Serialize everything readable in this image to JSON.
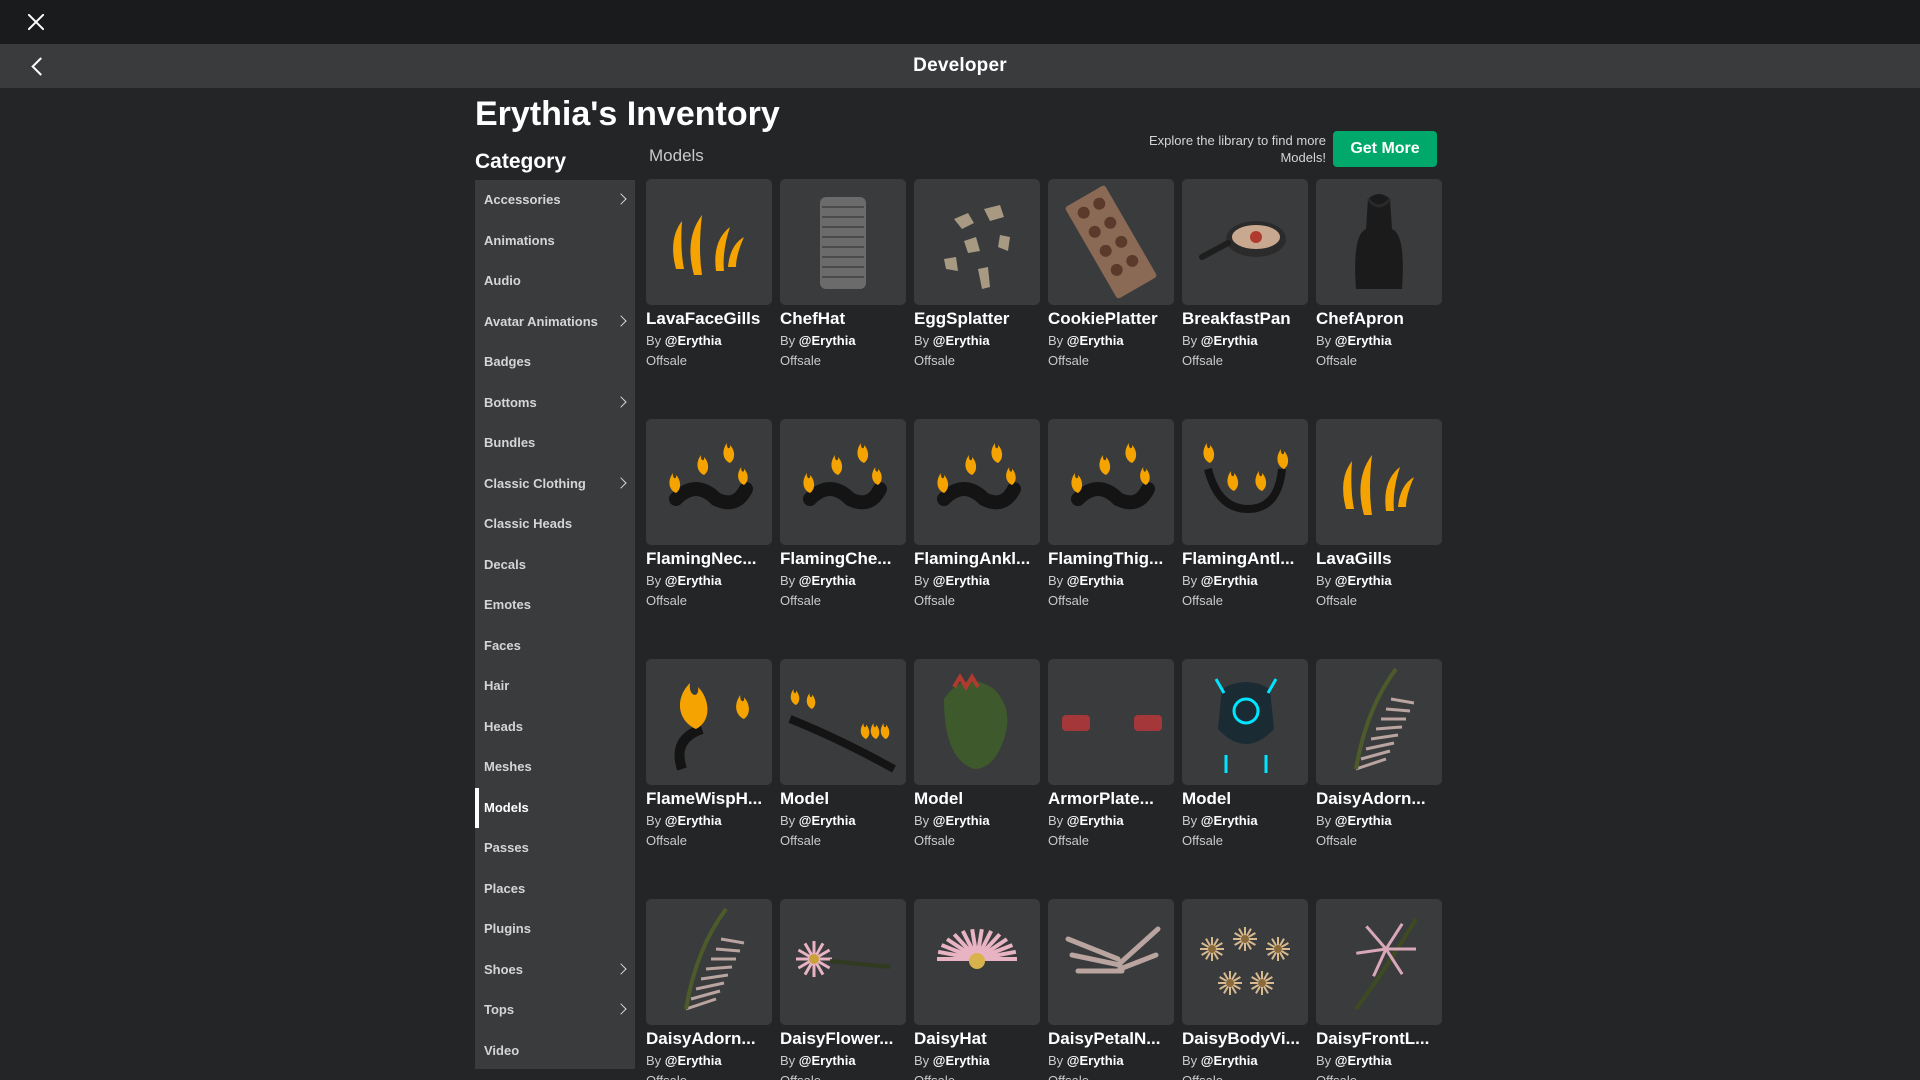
{
  "window": {
    "title": "Developer"
  },
  "page": {
    "title": "Erythia's Inventory"
  },
  "category": {
    "heading": "Category",
    "items": [
      {
        "label": "Accessories",
        "has_submenu": true
      },
      {
        "label": "Animations",
        "has_submenu": false
      },
      {
        "label": "Audio",
        "has_submenu": false
      },
      {
        "label": "Avatar Animations",
        "has_submenu": true
      },
      {
        "label": "Badges",
        "has_submenu": false
      },
      {
        "label": "Bottoms",
        "has_submenu": true
      },
      {
        "label": "Bundles",
        "has_submenu": false
      },
      {
        "label": "Classic Clothing",
        "has_submenu": true
      },
      {
        "label": "Classic Heads",
        "has_submenu": false
      },
      {
        "label": "Decals",
        "has_submenu": false
      },
      {
        "label": "Emotes",
        "has_submenu": false
      },
      {
        "label": "Faces",
        "has_submenu": false
      },
      {
        "label": "Hair",
        "has_submenu": false
      },
      {
        "label": "Heads",
        "has_submenu": false
      },
      {
        "label": "Meshes",
        "has_submenu": false
      },
      {
        "label": "Models",
        "has_submenu": false,
        "active": true
      },
      {
        "label": "Passes",
        "has_submenu": false
      },
      {
        "label": "Places",
        "has_submenu": false
      },
      {
        "label": "Plugins",
        "has_submenu": false
      },
      {
        "label": "Shoes",
        "has_submenu": true
      },
      {
        "label": "Tops",
        "has_submenu": true
      },
      {
        "label": "Video",
        "has_submenu": false
      }
    ]
  },
  "section": {
    "label": "Models"
  },
  "promo": {
    "text": "Explore the library to find more Models!",
    "button_label": "Get More"
  },
  "creator_prefix": "By",
  "items": [
    {
      "name": "LavaFaceGills",
      "creator": "@Erythia",
      "status": "Offsale",
      "icon": "lava-gills-thumbnail"
    },
    {
      "name": "ChefHat",
      "creator": "@Erythia",
      "status": "Offsale",
      "icon": "chef-hat-thumbnail"
    },
    {
      "name": "EggSplatter",
      "creator": "@Erythia",
      "status": "Offsale",
      "icon": "egg-splatter-thumbnail"
    },
    {
      "name": "CookiePlatter",
      "creator": "@Erythia",
      "status": "Offsale",
      "icon": "cookie-platter-thumbnail"
    },
    {
      "name": "BreakfastPan",
      "creator": "@Erythia",
      "status": "Offsale",
      "icon": "frying-pan-thumbnail"
    },
    {
      "name": "ChefApron",
      "creator": "@Erythia",
      "status": "Offsale",
      "icon": "apron-thumbnail"
    },
    {
      "name": "FlamingNec...",
      "creator": "@Erythia",
      "status": "Offsale",
      "icon": "flaming-accessory-thumbnail"
    },
    {
      "name": "FlamingChe...",
      "creator": "@Erythia",
      "status": "Offsale",
      "icon": "flaming-accessory-thumbnail"
    },
    {
      "name": "FlamingAnkl...",
      "creator": "@Erythia",
      "status": "Offsale",
      "icon": "flaming-accessory-thumbnail"
    },
    {
      "name": "FlamingThig...",
      "creator": "@Erythia",
      "status": "Offsale",
      "icon": "flaming-accessory-thumbnail"
    },
    {
      "name": "FlamingAntl...",
      "creator": "@Erythia",
      "status": "Offsale",
      "icon": "flaming-antlers-thumbnail"
    },
    {
      "name": "LavaGills",
      "creator": "@Erythia",
      "status": "Offsale",
      "icon": "lava-gills-thumbnail"
    },
    {
      "name": "FlameWispH...",
      "creator": "@Erythia",
      "status": "Offsale",
      "icon": "flame-wisp-thumbnail"
    },
    {
      "name": "Model",
      "creator": "@Erythia",
      "status": "Offsale",
      "icon": "flaming-tail-thumbnail"
    },
    {
      "name": "Model",
      "creator": "@Erythia",
      "status": "Offsale",
      "icon": "dragon-head-thumbnail"
    },
    {
      "name": "ArmorPlate...",
      "creator": "@Erythia",
      "status": "Offsale",
      "icon": "armor-plate-thumbnail"
    },
    {
      "name": "Model",
      "creator": "@Erythia",
      "status": "Offsale",
      "icon": "cyan-mask-thumbnail"
    },
    {
      "name": "DaisyAdorn...",
      "creator": "@Erythia",
      "status": "Offsale",
      "icon": "daisy-wing-thumbnail"
    },
    {
      "name": "DaisyAdorn...",
      "creator": "@Erythia",
      "status": "Offsale",
      "icon": "daisy-wing-thumbnail"
    },
    {
      "name": "DaisyFlower...",
      "creator": "@Erythia",
      "status": "Offsale",
      "icon": "daisy-flower-thumbnail"
    },
    {
      "name": "DaisyHat",
      "creator": "@Erythia",
      "status": "Offsale",
      "icon": "daisy-hat-thumbnail"
    },
    {
      "name": "DaisyPetalN...",
      "creator": "@Erythia",
      "status": "Offsale",
      "icon": "daisy-petals-thumbnail"
    },
    {
      "name": "DaisyBodyVi...",
      "creator": "@Erythia",
      "status": "Offsale",
      "icon": "daisy-vines-thumbnail"
    },
    {
      "name": "DaisyFrontL...",
      "creator": "@Erythia",
      "status": "Offsale",
      "icon": "daisy-front-thumbnail"
    }
  ],
  "colors": {
    "background": "#232527",
    "topbar": "#191b1d",
    "navbar": "#393b3d",
    "card": "#393b3d",
    "accent_green": "#00a86b",
    "flame": "#f5a300"
  }
}
